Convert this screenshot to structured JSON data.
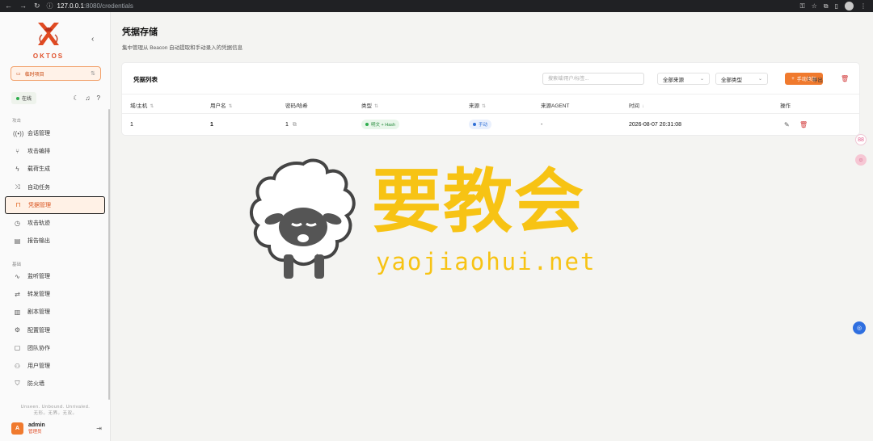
{
  "browser": {
    "url_host": "127.0.0.1",
    "url_path": ":8080/credentials"
  },
  "brand": {
    "name": "OKTOS"
  },
  "workspace": {
    "label": "临时项目"
  },
  "status": {
    "online_label": "在线"
  },
  "sidebar": {
    "groups": [
      {
        "label": "攻击",
        "items": [
          {
            "label": "会话管理",
            "icon": "signal-icon"
          },
          {
            "label": "攻击编排",
            "icon": "workflow-icon"
          },
          {
            "label": "载荷生成",
            "icon": "bolt-icon"
          },
          {
            "label": "自动任务",
            "icon": "shuffle-icon"
          },
          {
            "label": "凭据管理",
            "icon": "lock-icon",
            "active": true
          },
          {
            "label": "攻击轨迹",
            "icon": "clock-icon"
          },
          {
            "label": "报告输出",
            "icon": "document-icon"
          }
        ]
      },
      {
        "label": "基础",
        "items": [
          {
            "label": "监听管理",
            "icon": "pulse-icon"
          },
          {
            "label": "转发管理",
            "icon": "forward-icon"
          },
          {
            "label": "剧本管理",
            "icon": "book-icon"
          },
          {
            "label": "配置管理",
            "icon": "gear-icon"
          },
          {
            "label": "团队协作",
            "icon": "chat-icon"
          },
          {
            "label": "用户管理",
            "icon": "users-icon"
          },
          {
            "label": "防火墙",
            "icon": "shield-icon"
          }
        ]
      }
    ],
    "tagline_en": "Unseen. Unbound. Unrivaled.",
    "tagline_cn": "无形。无界。无双。"
  },
  "user": {
    "initial": "A",
    "name": "admin",
    "role": "管理员"
  },
  "page": {
    "title": "凭据存储",
    "subtitle": "集中管理从 Beacon 自动提取和手动录入的凭据信息"
  },
  "card": {
    "title": "凭据列表",
    "search_placeholder": "搜索域/用户/标签...",
    "filter_source": "全部来源",
    "filter_type": "全部类型",
    "add_label": "手动添加",
    "export_label": "导出",
    "columns": [
      "域/主机",
      "用户名",
      "密码/哈希",
      "类型",
      "来源",
      "来源AGENT",
      "时间",
      "操作"
    ],
    "rows": [
      {
        "domain": "1",
        "username": "1",
        "secret": "1",
        "type": "明文 + Hash",
        "source": "手动",
        "agent": "-",
        "time": "2026-08-07 20:31:08"
      }
    ]
  },
  "watermark": {
    "text": "要教会",
    "url": "yaojiaohui.net"
  }
}
